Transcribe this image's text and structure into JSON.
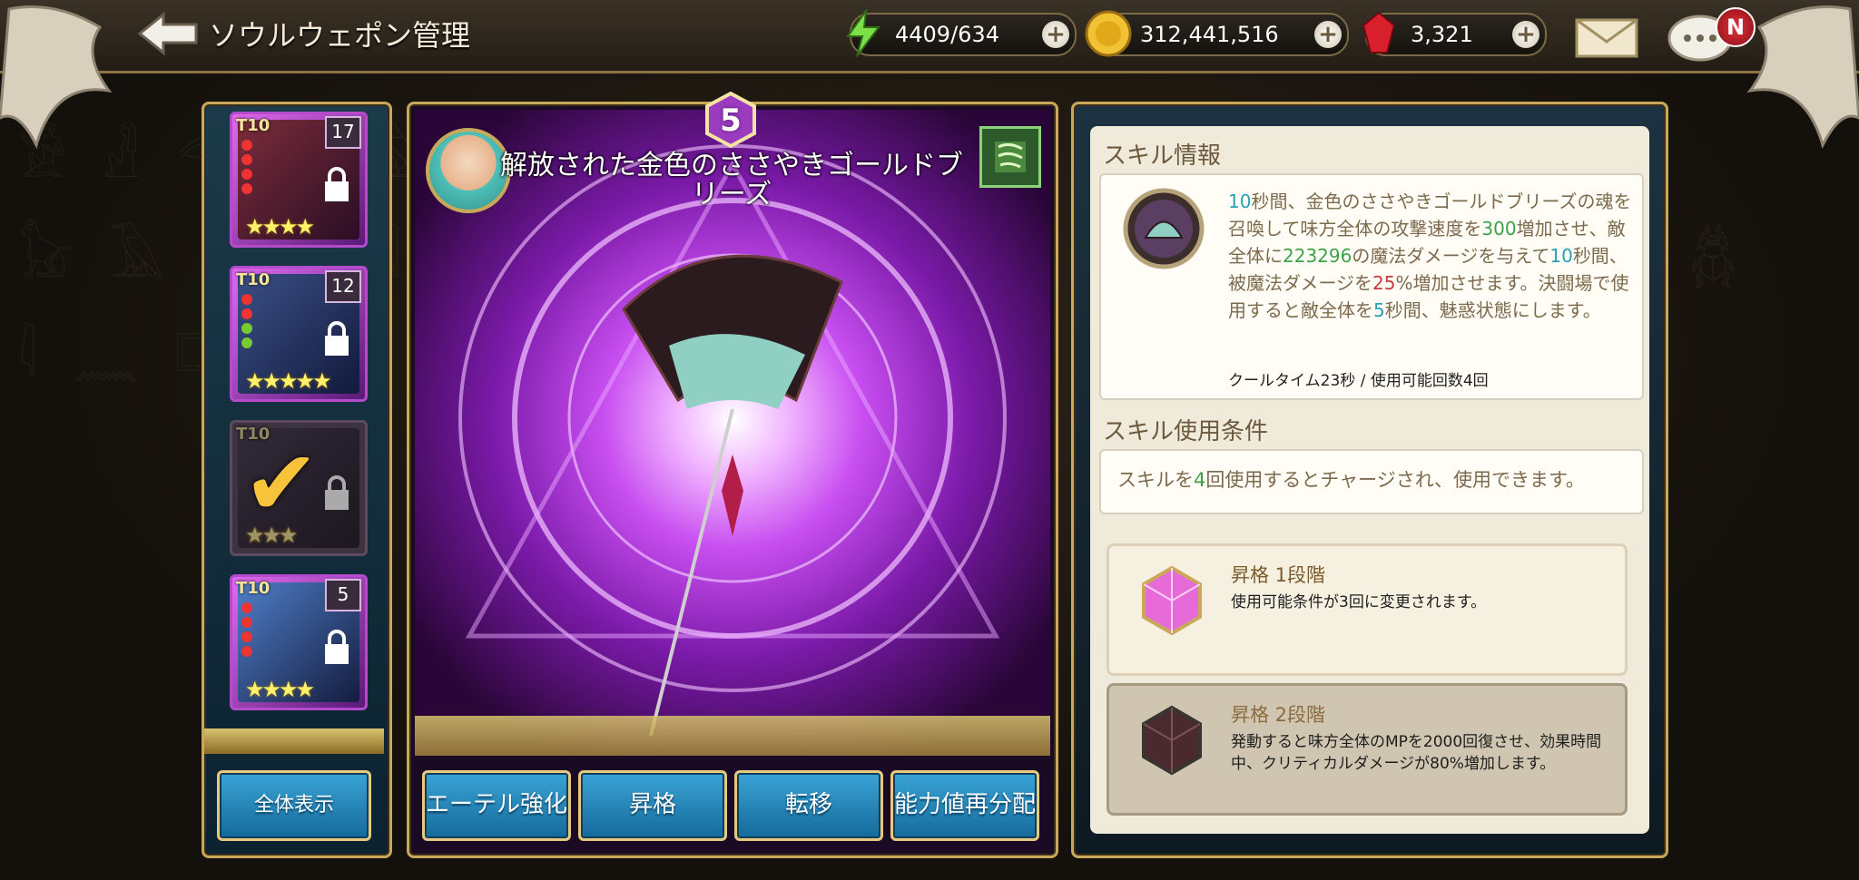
{
  "header": {
    "title": "ソウルウェポン管理",
    "stamina": "4409/634",
    "gold": "312,441,516",
    "gems": "3,321",
    "notification_badge": "N"
  },
  "sidebar": {
    "cards": [
      {
        "tier": "T10",
        "level": "17",
        "stars": "★★★★",
        "locked": true
      },
      {
        "tier": "T10",
        "level": "12",
        "stars": "★★★★★",
        "locked": true
      },
      {
        "tier": "T10",
        "level": "",
        "stars": "★★★",
        "locked": true,
        "selected": true
      },
      {
        "tier": "T10",
        "level": "5",
        "stars": "★★★★",
        "locked": true
      }
    ],
    "show_all_label": "全体表示"
  },
  "weapon": {
    "grade": "5",
    "name": "解放された金色のささやきゴールドブリーズ"
  },
  "actions": {
    "aether": "エーテル強化",
    "ascend": "昇格",
    "transfer": "転移",
    "redistribute": "能力値再分配"
  },
  "skill": {
    "section_title": "スキル情報",
    "desc_parts": [
      "10",
      "秒間、金色のささやきゴールドブリーズの魂を召喚して味方全体の攻撃速度を",
      "300",
      "増加させ、敵全体に",
      "223296",
      "の魔法ダメージを与えて",
      "10",
      "秒間、被魔法ダメージを",
      "25",
      "%増加させます。決闘場で使用すると敵全体を",
      "5",
      "秒間、魅惑状態にします。"
    ],
    "cooldown": "クールタイム23秒 / 使用可能回数4回"
  },
  "conditions": {
    "section_title": "スキル使用条件",
    "text_pre": "スキルを",
    "count": "4",
    "text_post": "回使用するとチャージされ、使用できます。"
  },
  "ascension": [
    {
      "title": "昇格 1段階",
      "text": "使用可能条件が3回に変更されます。"
    },
    {
      "title": "昇格 2段階",
      "text": "発動すると味方全体のMPを2000回復させ、効果時間中、クリティカルダメージが80%増加します。"
    }
  ]
}
